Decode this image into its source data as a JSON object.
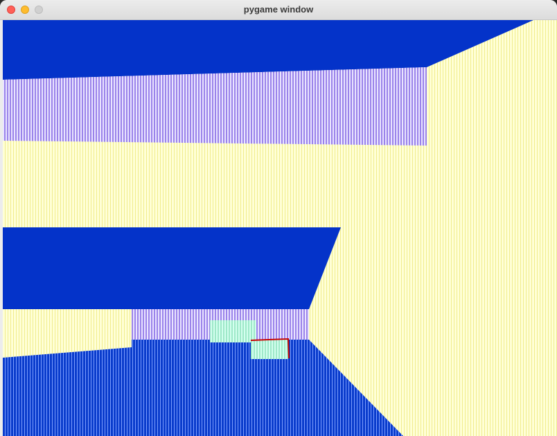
{
  "window": {
    "title": "pygame window"
  },
  "colors": {
    "ceiling_blue": "#0433c9",
    "wall_yellow": "#ffffc4",
    "wall_purple": "#b7a6ff",
    "floor_blue": "#0433c9",
    "sprite_cyan": "#b4ffe1",
    "sprite_red": "#c80000"
  }
}
